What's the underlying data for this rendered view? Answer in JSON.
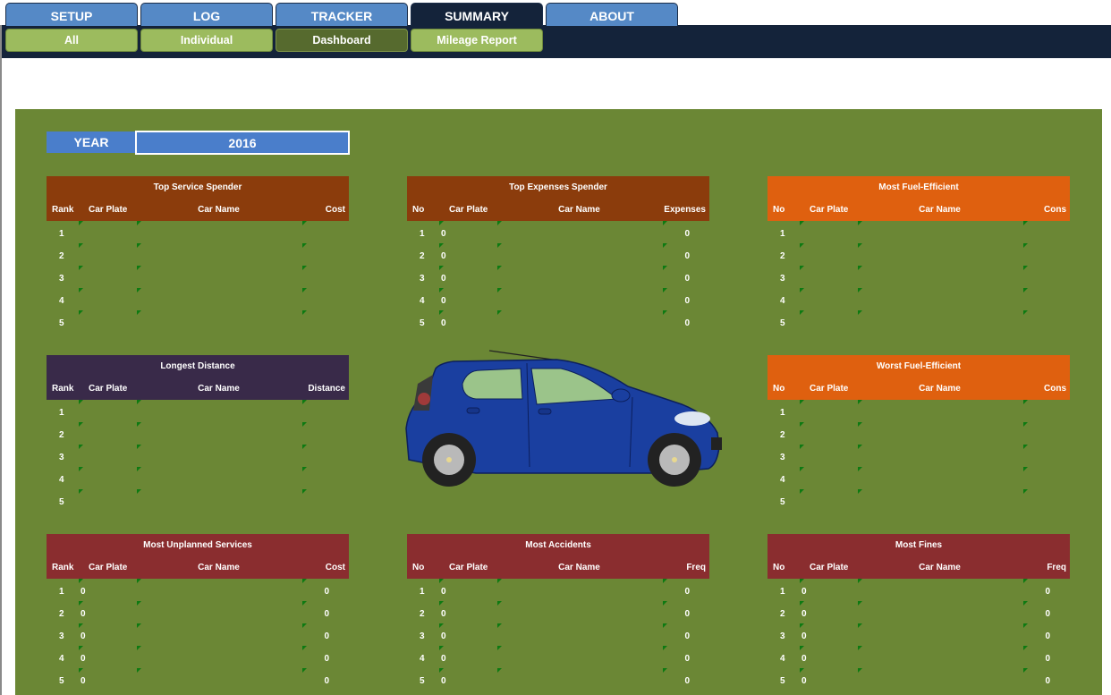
{
  "nav": {
    "tabs": [
      {
        "label": "SETUP",
        "active": false
      },
      {
        "label": "LOG",
        "active": false
      },
      {
        "label": "TRACKER",
        "active": false
      },
      {
        "label": "SUMMARY",
        "active": true
      },
      {
        "label": "ABOUT",
        "active": false
      }
    ],
    "subtabs": [
      {
        "label": "All",
        "active": false
      },
      {
        "label": "Individual",
        "active": false
      },
      {
        "label": "Dashboard",
        "active": true
      },
      {
        "label": "Mileage Report",
        "active": false
      }
    ]
  },
  "dashboard": {
    "year_label": "YEAR",
    "year_value": "2016",
    "car_image": "car-illustration",
    "tables": [
      {
        "id": "top-service-spender",
        "title": "Top Service Spender",
        "color": "#8b3c0c",
        "headers": [
          "Rank",
          "Car Plate",
          "Car Name",
          "Cost"
        ],
        "rows": [
          [
            "1",
            "",
            "",
            ""
          ],
          [
            "2",
            "",
            "",
            ""
          ],
          [
            "3",
            "",
            "",
            ""
          ],
          [
            "4",
            "",
            "",
            ""
          ],
          [
            "5",
            "",
            "",
            ""
          ]
        ]
      },
      {
        "id": "top-expenses-spender",
        "title": "Top Expenses Spender",
        "color": "#8b3c0c",
        "headers": [
          "No",
          "Car Plate",
          "Car Name",
          "Expenses"
        ],
        "rows": [
          [
            "1",
            "0",
            "",
            "0"
          ],
          [
            "2",
            "0",
            "",
            "0"
          ],
          [
            "3",
            "0",
            "",
            "0"
          ],
          [
            "4",
            "0",
            "",
            "0"
          ],
          [
            "5",
            "0",
            "",
            "0"
          ]
        ]
      },
      {
        "id": "most-fuel-efficient",
        "title": "Most Fuel-Efficient",
        "color": "#df600f",
        "headers": [
          "No",
          "Car Plate",
          "Car Name",
          "Cons"
        ],
        "rows": [
          [
            "1",
            "",
            "",
            ""
          ],
          [
            "2",
            "",
            "",
            ""
          ],
          [
            "3",
            "",
            "",
            ""
          ],
          [
            "4",
            "",
            "",
            ""
          ],
          [
            "5",
            "",
            "",
            ""
          ]
        ]
      },
      {
        "id": "longest-distance",
        "title": "Longest Distance",
        "color": "#392a49",
        "headers": [
          "Rank",
          "Car Plate",
          "Car Name",
          "Distance"
        ],
        "rows": [
          [
            "1",
            "",
            "",
            ""
          ],
          [
            "2",
            "",
            "",
            ""
          ],
          [
            "3",
            "",
            "",
            ""
          ],
          [
            "4",
            "",
            "",
            ""
          ],
          [
            "5",
            "",
            "",
            ""
          ]
        ]
      },
      {
        "id": "worst-fuel-efficient",
        "title": "Worst Fuel-Efficient",
        "color": "#df600f",
        "headers": [
          "No",
          "Car Plate",
          "Car Name",
          "Cons"
        ],
        "rows": [
          [
            "1",
            "",
            "",
            ""
          ],
          [
            "2",
            "",
            "",
            ""
          ],
          [
            "3",
            "",
            "",
            ""
          ],
          [
            "4",
            "",
            "",
            ""
          ],
          [
            "5",
            "",
            "",
            ""
          ]
        ]
      },
      {
        "id": "most-unplanned-services",
        "title": "Most Unplanned Services",
        "color": "#8a2d2f",
        "headers": [
          "Rank",
          "Car Plate",
          "Car Name",
          "Cost"
        ],
        "rows": [
          [
            "1",
            "0",
            "",
            "0"
          ],
          [
            "2",
            "0",
            "",
            "0"
          ],
          [
            "3",
            "0",
            "",
            "0"
          ],
          [
            "4",
            "0",
            "",
            "0"
          ],
          [
            "5",
            "0",
            "",
            "0"
          ]
        ]
      },
      {
        "id": "most-accidents",
        "title": "Most Accidents",
        "color": "#8a2d2f",
        "headers": [
          "No",
          "Car Plate",
          "Car Name",
          "Freq"
        ],
        "rows": [
          [
            "1",
            "0",
            "",
            "0"
          ],
          [
            "2",
            "0",
            "",
            "0"
          ],
          [
            "3",
            "0",
            "",
            "0"
          ],
          [
            "4",
            "0",
            "",
            "0"
          ],
          [
            "5",
            "0",
            "",
            "0"
          ]
        ]
      },
      {
        "id": "most-fines",
        "title": "Most Fines",
        "color": "#8a2d2f",
        "headers": [
          "No",
          "Car Plate",
          "Car Name",
          "Freq"
        ],
        "rows": [
          [
            "1",
            "0",
            "",
            "0"
          ],
          [
            "2",
            "0",
            "",
            "0"
          ],
          [
            "3",
            "0",
            "",
            "0"
          ],
          [
            "4",
            "0",
            "",
            "0"
          ],
          [
            "5",
            "0",
            "",
            "0"
          ]
        ]
      }
    ]
  }
}
